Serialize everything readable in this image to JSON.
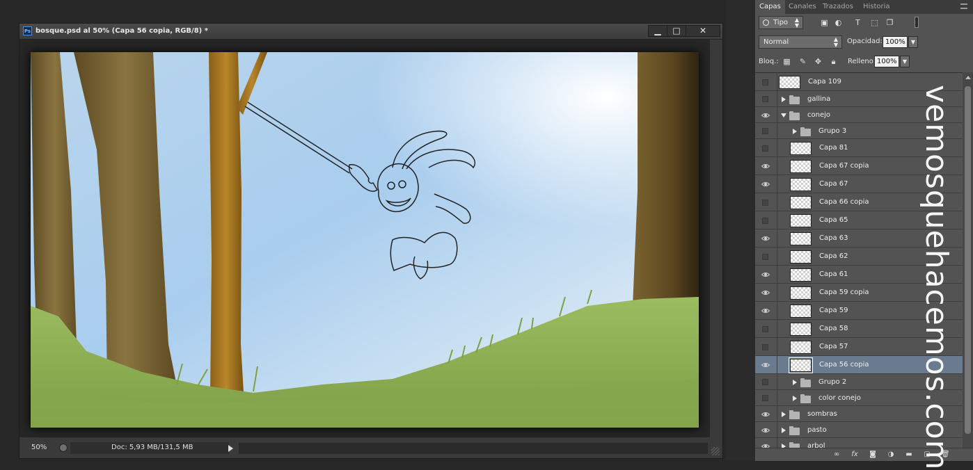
{
  "document": {
    "title": "bosque.psd al 50% (Capa 56 copia, RGB/8) *",
    "app_icon": "Ps",
    "buttons": {
      "minimize": "▁",
      "maximize": "□",
      "close": "✕"
    },
    "zoom": "50%",
    "doc_info": "Doc: 5,93 MB/131,5 MB"
  },
  "panel": {
    "tabs": [
      "Capas",
      "Canales",
      "Trazados",
      "Historia"
    ],
    "active_tab": "Capas",
    "filter_kind": "Tipo",
    "blend_mode": "Normal",
    "opacity_label": "Opacidad:",
    "opacity_value": "100%",
    "lock_label": "Bloq.:",
    "fill_label": "Relleno:",
    "fill_value": "100%",
    "layers": [
      {
        "name": "Capa 109",
        "type": "layer",
        "visible": false,
        "indent": 0
      },
      {
        "name": "gallina",
        "type": "group-closed",
        "visible": false,
        "indent": 0
      },
      {
        "name": "conejo",
        "type": "group-open",
        "visible": true,
        "indent": 0
      },
      {
        "name": "Grupo 3",
        "type": "group-closed",
        "visible": false,
        "indent": 1
      },
      {
        "name": "Capa 81",
        "type": "layer",
        "visible": false,
        "indent": 1
      },
      {
        "name": "Capa 67 copia",
        "type": "layer",
        "visible": true,
        "indent": 1
      },
      {
        "name": "Capa 67",
        "type": "layer",
        "visible": true,
        "indent": 1
      },
      {
        "name": "Capa 66 copia",
        "type": "layer",
        "visible": false,
        "indent": 1
      },
      {
        "name": "Capa 65",
        "type": "layer",
        "visible": false,
        "indent": 1
      },
      {
        "name": "Capa 63",
        "type": "layer",
        "visible": true,
        "indent": 1
      },
      {
        "name": "Capa 62",
        "type": "layer",
        "visible": false,
        "indent": 1
      },
      {
        "name": "Capa 61",
        "type": "layer",
        "visible": true,
        "indent": 1
      },
      {
        "name": "Capa 59 copia",
        "type": "layer",
        "visible": true,
        "indent": 1
      },
      {
        "name": "Capa 59",
        "type": "layer",
        "visible": true,
        "indent": 1
      },
      {
        "name": "Capa 58",
        "type": "layer",
        "visible": false,
        "indent": 1
      },
      {
        "name": "Capa 57",
        "type": "layer",
        "visible": false,
        "indent": 1
      },
      {
        "name": "Capa 56 copia",
        "type": "layer",
        "visible": true,
        "indent": 1,
        "selected": true
      },
      {
        "name": "Grupo 2",
        "type": "group-closed",
        "visible": false,
        "indent": 1
      },
      {
        "name": "color conejo",
        "type": "group-closed",
        "visible": false,
        "indent": 1
      },
      {
        "name": "sombras",
        "type": "group-closed",
        "visible": true,
        "indent": 0
      },
      {
        "name": "pasto",
        "type": "group-closed",
        "visible": true,
        "indent": 0
      },
      {
        "name": "arbol",
        "type": "group-closed",
        "visible": true,
        "indent": 0
      }
    ]
  },
  "watermark": "vemosquehacemos.com",
  "colors": {
    "selected_row": "#6a7a8f",
    "panel_bg": "#535353",
    "app_bg": "#282828"
  }
}
